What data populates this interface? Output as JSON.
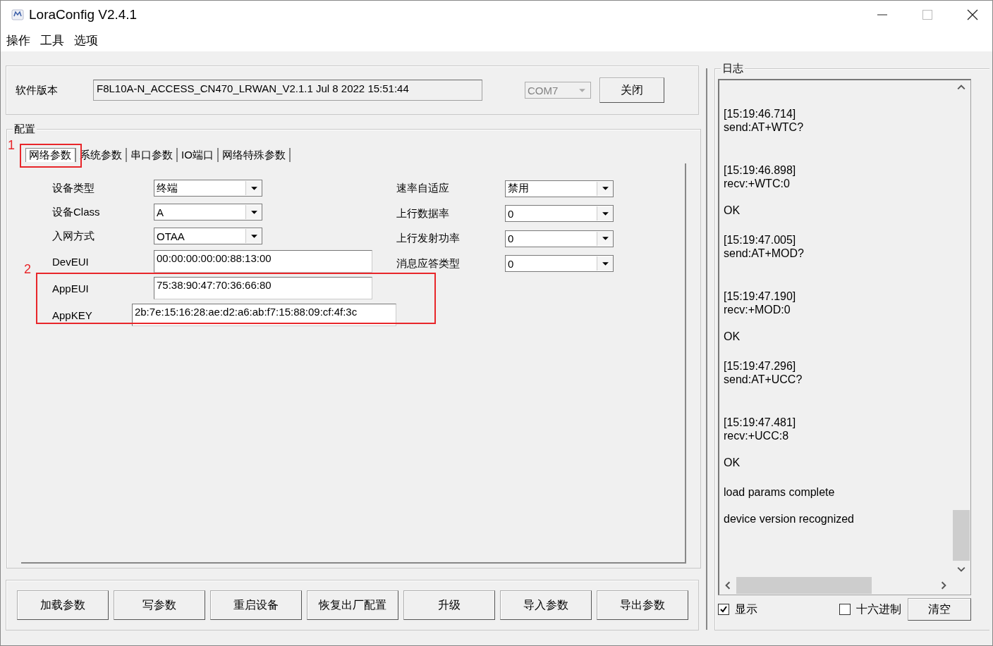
{
  "window": {
    "title": "LoraConfig V2.4.1"
  },
  "menu": [
    "操作",
    "工具",
    "选项"
  ],
  "version": {
    "label": "软件版本",
    "value": "F8L10A-N_ACCESS_CN470_LRWAN_V2.1.1 Jul  8 2022 15:51:44",
    "port": {
      "value": "COM7",
      "disabled": true
    },
    "button": "关闭"
  },
  "config": {
    "title": "配置",
    "tabs": [
      {
        "label": "网络参数",
        "selected": true
      },
      {
        "label": "系统参数",
        "selected": false
      },
      {
        "label": "串口参数",
        "selected": false
      },
      {
        "label": "IO端口",
        "selected": false
      },
      {
        "label": "网络特殊参数",
        "selected": false
      }
    ],
    "left_fields": [
      {
        "label": "设备类型",
        "kind": "select",
        "value": "终端"
      },
      {
        "label": "设备Class",
        "kind": "select",
        "value": "A"
      },
      {
        "label": "入网方式",
        "kind": "select",
        "value": "OTAA"
      },
      {
        "label": "DevEUI",
        "kind": "text",
        "value": "00:00:00:00:00:88:13:00"
      },
      {
        "label": "AppEUI",
        "kind": "text",
        "value": "75:38:90:47:70:36:66:80"
      },
      {
        "label": "AppKEY",
        "kind": "wide",
        "value": "2b:7e:15:16:28:ae:d2:a6:ab:f7:15:88:09:cf:4f:3c"
      }
    ],
    "right_fields": [
      {
        "label": "速率自适应",
        "kind": "select",
        "value": "禁用"
      },
      {
        "label": "上行数据率",
        "kind": "select",
        "value": "0"
      },
      {
        "label": "上行发射功率",
        "kind": "select",
        "value": "0"
      },
      {
        "label": "消息应答类型",
        "kind": "select",
        "value": "0"
      }
    ]
  },
  "annotations": [
    {
      "label": "1"
    },
    {
      "label": "2"
    }
  ],
  "buttons": [
    "加载参数",
    "写参数",
    "重启设备",
    "恢复出厂配置",
    "升级",
    "导入参数",
    "导出参数"
  ],
  "log": {
    "title": "日志",
    "entries": [
      {
        "kind": "command",
        "time": "[15:19:46.714]",
        "text": "send:AT+WTC?"
      },
      {
        "kind": "command",
        "time": "[15:19:46.898]",
        "text": "recv:+WTC:0",
        "status": "OK"
      },
      {
        "kind": "command",
        "time": "[15:19:47.005]",
        "text": "send:AT+MOD?"
      },
      {
        "kind": "command",
        "time": "[15:19:47.190]",
        "text": "recv:+MOD:0",
        "status": "OK"
      },
      {
        "kind": "command",
        "time": "[15:19:47.296]",
        "text": "send:AT+UCC?"
      },
      {
        "kind": "command",
        "time": "[15:19:47.481]",
        "text": "recv:+UCC:8",
        "status": "OK"
      },
      {
        "kind": "message",
        "text": "load params complete"
      },
      {
        "kind": "message",
        "text": "device version recognized"
      }
    ],
    "show": {
      "label": "显示",
      "checked": true
    },
    "hex": {
      "label": "十六进制",
      "checked": false
    },
    "clear": "清空"
  }
}
